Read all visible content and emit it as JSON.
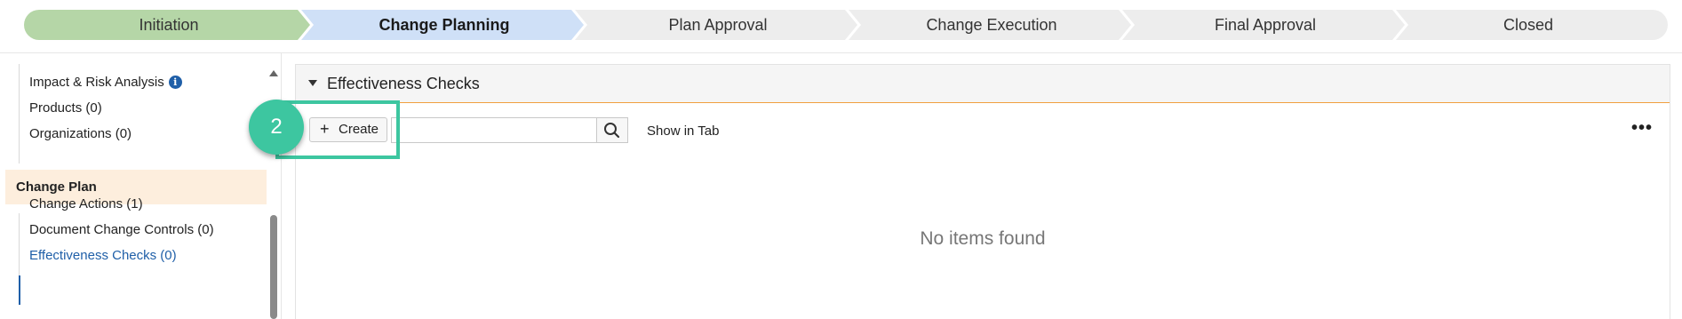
{
  "progress": {
    "stages": [
      {
        "label": "Initiation",
        "status": "completed"
      },
      {
        "label": "Change Planning",
        "status": "current"
      },
      {
        "label": "Plan Approval",
        "status": "pending"
      },
      {
        "label": "Change Execution",
        "status": "pending"
      },
      {
        "label": "Final Approval",
        "status": "pending"
      },
      {
        "label": "Closed",
        "status": "pending"
      }
    ],
    "colors": {
      "completed": "#b5d6a7",
      "current": "#cfe0f7",
      "pending": "#ededed"
    }
  },
  "sidebar": {
    "items_top": [
      {
        "label": "Impact & Risk Analysis",
        "icon": "info-icon"
      },
      {
        "label": "Products (0)"
      },
      {
        "label": "Organizations (0)"
      }
    ],
    "section_header": "Change Plan",
    "items_bottom": [
      {
        "label": "Change Actions (1)"
      },
      {
        "label": "Document Change Controls (0)"
      },
      {
        "label": "Effectiveness Checks (0)",
        "active": true
      }
    ],
    "info_icon_glyph": "i"
  },
  "panel": {
    "title": "Effectiveness Checks",
    "create_label": "Create",
    "create_icon": "plus-icon",
    "search": {
      "value": "",
      "placeholder": ""
    },
    "show_in_tab_label": "Show in Tab",
    "more_icon": "more-icon",
    "empty_message": "No items found"
  },
  "annotation": {
    "step_number": "2",
    "color": "#3dc6a0"
  }
}
